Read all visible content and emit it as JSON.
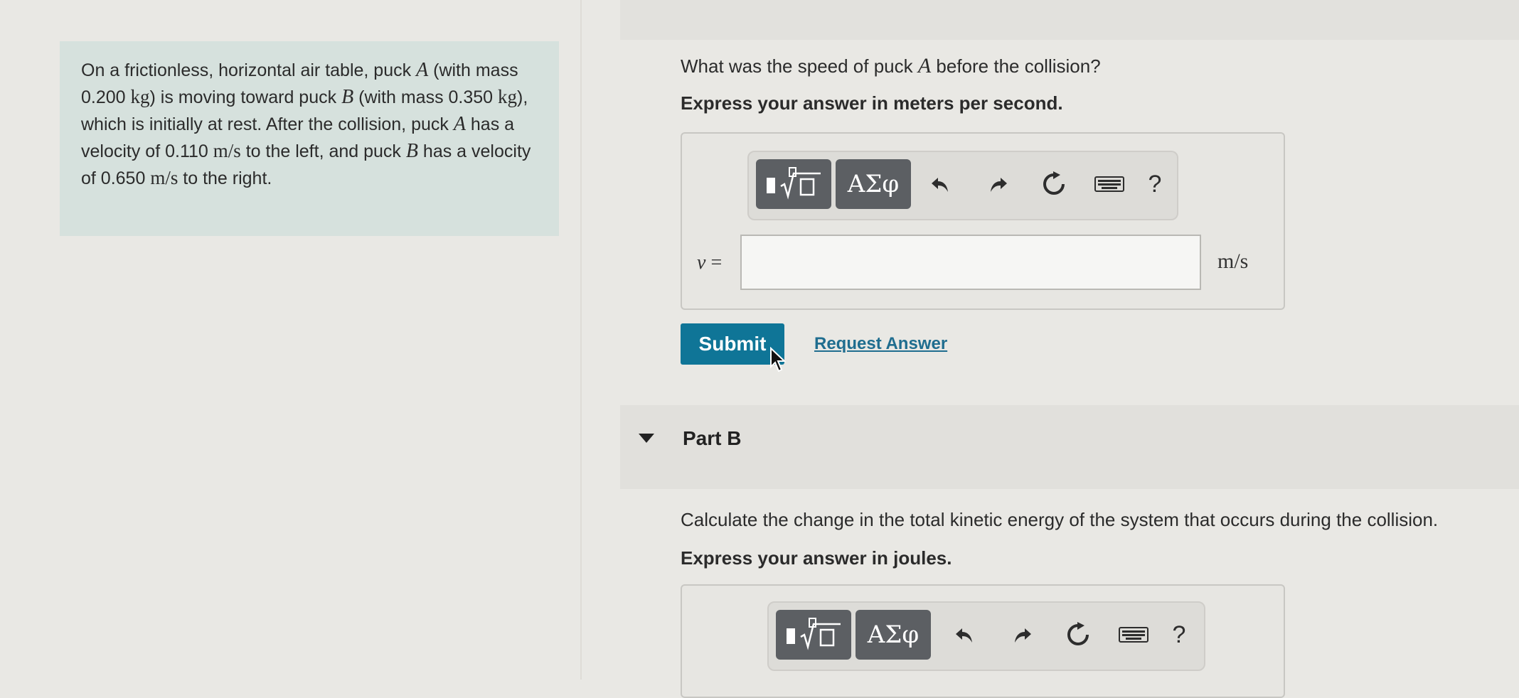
{
  "problem": {
    "t1": "On a frictionless, horizontal air table, puck ",
    "pA1": "A",
    "t2": " (with mass 0.200 ",
    "kg1": "kg",
    "t3": ") is moving toward puck ",
    "pB1": "B",
    "t4": " (with mass 0.350 ",
    "kg2": "kg",
    "t5": "), which is initially at rest. After the collision, puck ",
    "pA2": "A",
    "t6": " has a velocity of 0.110 ",
    "ms1": "m/s",
    "t7": " to the left, and puck ",
    "pB2": "B",
    "t8": " has a velocity of 0.650 ",
    "ms2": "m/s",
    "t9": " to the right."
  },
  "partA": {
    "q_before": "What was the speed of puck ",
    "q_var": "A",
    "q_after": " before the collision?",
    "instruction": "Express your answer in meters per second.",
    "toolbar": {
      "templates_icon": "fraction-root-template-icon",
      "greek_label": "ΑΣφ",
      "undo_icon": "undo-icon",
      "redo_icon": "redo-icon",
      "reset_icon": "reset-icon",
      "keyboard_icon": "keyboard-icon",
      "help_label": "?"
    },
    "variable": "v",
    "equals": "=",
    "answer_value": "",
    "unit": "m/s",
    "submit_label": "Submit",
    "request_label": "Request Answer"
  },
  "partB": {
    "title": "Part B",
    "question": "Calculate the change in the total kinetic energy of the system that occurs during the collision.",
    "instruction": "Express your answer in joules.",
    "toolbar": {
      "greek_label": "ΑΣφ",
      "help_label": "?"
    }
  },
  "colors": {
    "submit": "#0f7597",
    "link": "#1f6d8f",
    "problem_bg": "#d6e1dd",
    "toolbar_button": "#5c5f63"
  }
}
